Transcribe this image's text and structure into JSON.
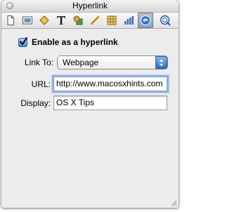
{
  "window": {
    "title": "Hyperlink"
  },
  "toolbar": {
    "tools": [
      {
        "name": "document-tool-icon"
      },
      {
        "name": "canvas-tool-icon"
      },
      {
        "name": "fill-tool-icon"
      },
      {
        "name": "text-tool-icon"
      },
      {
        "name": "shapes-tool-icon"
      },
      {
        "name": "line-tool-icon"
      },
      {
        "name": "table-tool-icon"
      },
      {
        "name": "chart-tool-icon"
      },
      {
        "name": "hyperlink-tool-icon"
      },
      {
        "name": "quicktime-tool-icon"
      }
    ],
    "selected_tool": "hyperlink-tool-icon"
  },
  "form": {
    "enable_label": "Enable as a hyperlink",
    "enable_checked": true,
    "link_to_label": "Link To:",
    "link_to_value": "Webpage",
    "url_label": "URL:",
    "url_value": "http://www.macosxhints.com",
    "display_label": "Display:",
    "display_value": "OS X Tips"
  },
  "colors": {
    "accent": "#3f7fd2",
    "focus_ring": "#8fb6ea",
    "window_bg": "#ececec"
  }
}
